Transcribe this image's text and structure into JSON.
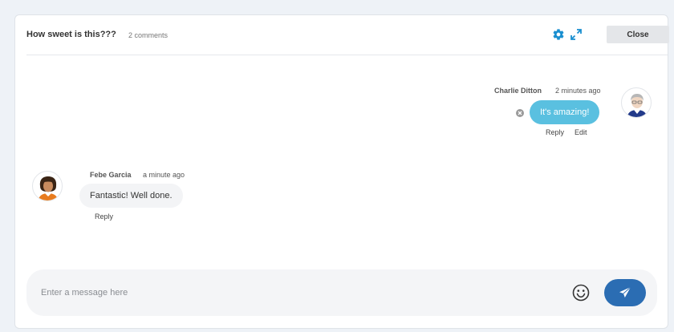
{
  "header": {
    "title": "How sweet is this???",
    "comment_count": "2 comments",
    "close_label": "Close"
  },
  "colors": {
    "accent": "#2b6db3",
    "own_bubble": "#5ac0e0",
    "other_bubble": "#f3f4f6"
  },
  "messages": [
    {
      "author": "Charlie Ditton",
      "time": "2 minutes ago",
      "text": "It's amazing!",
      "own": true,
      "actions": [
        "Reply",
        "Edit"
      ]
    },
    {
      "author": "Febe Garcia",
      "time": "a minute ago",
      "text": "Fantastic! Well done.",
      "own": false,
      "actions": [
        "Reply"
      ]
    }
  ],
  "composer": {
    "placeholder": "Enter a message here"
  },
  "icons": [
    "gear-icon",
    "expand-icon",
    "delete-icon",
    "emoji-icon",
    "send-icon"
  ]
}
